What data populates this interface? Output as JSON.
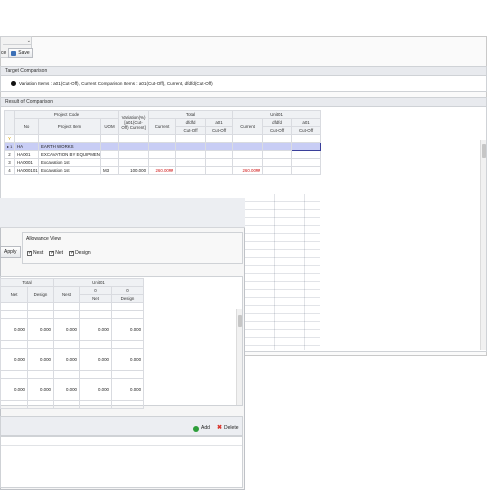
{
  "toolbar": {
    "partial_label": "ce",
    "save_label": "Save"
  },
  "target": {
    "title": "Target Comparison",
    "description": "Variation Items : a01(Cut-Off), Current  Comparison Items : a01(Cut-Off), Current, dfdfd(Cut-Off)"
  },
  "result": {
    "title": "Result of Comparison",
    "headers": {
      "project_code": "Project Code",
      "no": "No",
      "project_item": "Project Item",
      "uom": "UOM",
      "variation": "Variation(%) [a01(Cut-Off) Current]",
      "total": "Total",
      "unit01": "Unit01",
      "current": "Current",
      "dfdfd": "dfdfd",
      "a01": "a01",
      "cutoff": "Cut-Off"
    },
    "filter_icon_label": "Y",
    "rows": [
      {
        "no": "1",
        "code": "HA",
        "item": "EARTH WORKS",
        "uom": "",
        "var": "",
        "current": "",
        "dfdfd": "",
        "a01": "",
        "u_current": "",
        "u_dfdfd": "",
        "u_a01": ""
      },
      {
        "no": "2",
        "code": "HA001",
        "item": "EXCAVATION BY EQUIPMENT",
        "uom": "",
        "var": "",
        "current": "",
        "dfdfd": "",
        "a01": "",
        "u_current": "",
        "u_dfdfd": "",
        "u_a01": ""
      },
      {
        "no": "3",
        "code": "HA0001",
        "item": "Excavation 1st",
        "uom": "",
        "var": "",
        "current": "",
        "dfdfd": "",
        "a01": "",
        "u_current": "",
        "u_dfdfd": "",
        "u_a01": ""
      },
      {
        "no": "4",
        "code": "HA000101",
        "item": "Excavation 1st",
        "uom": "M3",
        "var": "100.000",
        "current": "260.00₩",
        "dfdfd": "",
        "a01": "",
        "u_current": "260.00₩",
        "u_dfdfd": "",
        "u_a01": ""
      }
    ]
  },
  "allowance": {
    "title": "Allowance View",
    "apply_label": "Apply",
    "options": [
      {
        "label": "Nest",
        "checked": true
      },
      {
        "label": "Net",
        "checked": true
      },
      {
        "label": "Design",
        "checked": true
      }
    ]
  },
  "lower_grid": {
    "total": "Total",
    "unit01": "Unit01",
    "net": "Net",
    "design": "Design",
    "nest": "Nest",
    "zero": "0",
    "rows": [
      [
        "0.000",
        "0.000",
        "0.000",
        "0.000",
        "0.000"
      ],
      [
        "0.000",
        "0.000",
        "0.000",
        "0.000",
        "0.000"
      ],
      [
        "0.000",
        "0.000",
        "0.000",
        "0.000",
        "0.000"
      ]
    ]
  },
  "bottom_panel": {
    "add_label": "Add",
    "delete_label": "Delete"
  },
  "colors": {
    "selected_row": "#c8cdf5",
    "red_value": "#d11a1a",
    "add_icon": "#2e9e3a",
    "delete_icon": "#d9342b"
  }
}
